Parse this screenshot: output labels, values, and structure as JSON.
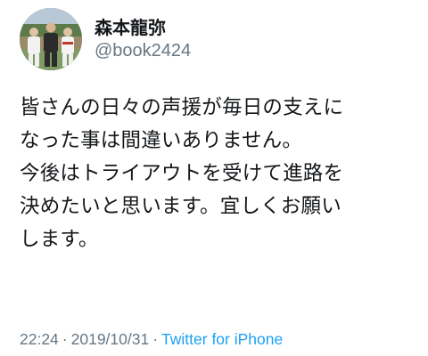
{
  "user": {
    "display_name": "森本龍弥",
    "handle": "@book2424"
  },
  "tweet": {
    "lines": [
      "皆さんの日々の声援が毎日の支えに",
      "なった事は間違いありません。",
      "今後はトライアウトを受けて進路を",
      "決めたいと思います。宜しくお願い",
      "します。"
    ]
  },
  "meta": {
    "time": "22:24",
    "separator": "·",
    "date": "2019/10/31",
    "source": "Twitter for iPhone"
  },
  "colors": {
    "text": "#14171a",
    "muted": "#657786",
    "link": "#1da1f2"
  }
}
